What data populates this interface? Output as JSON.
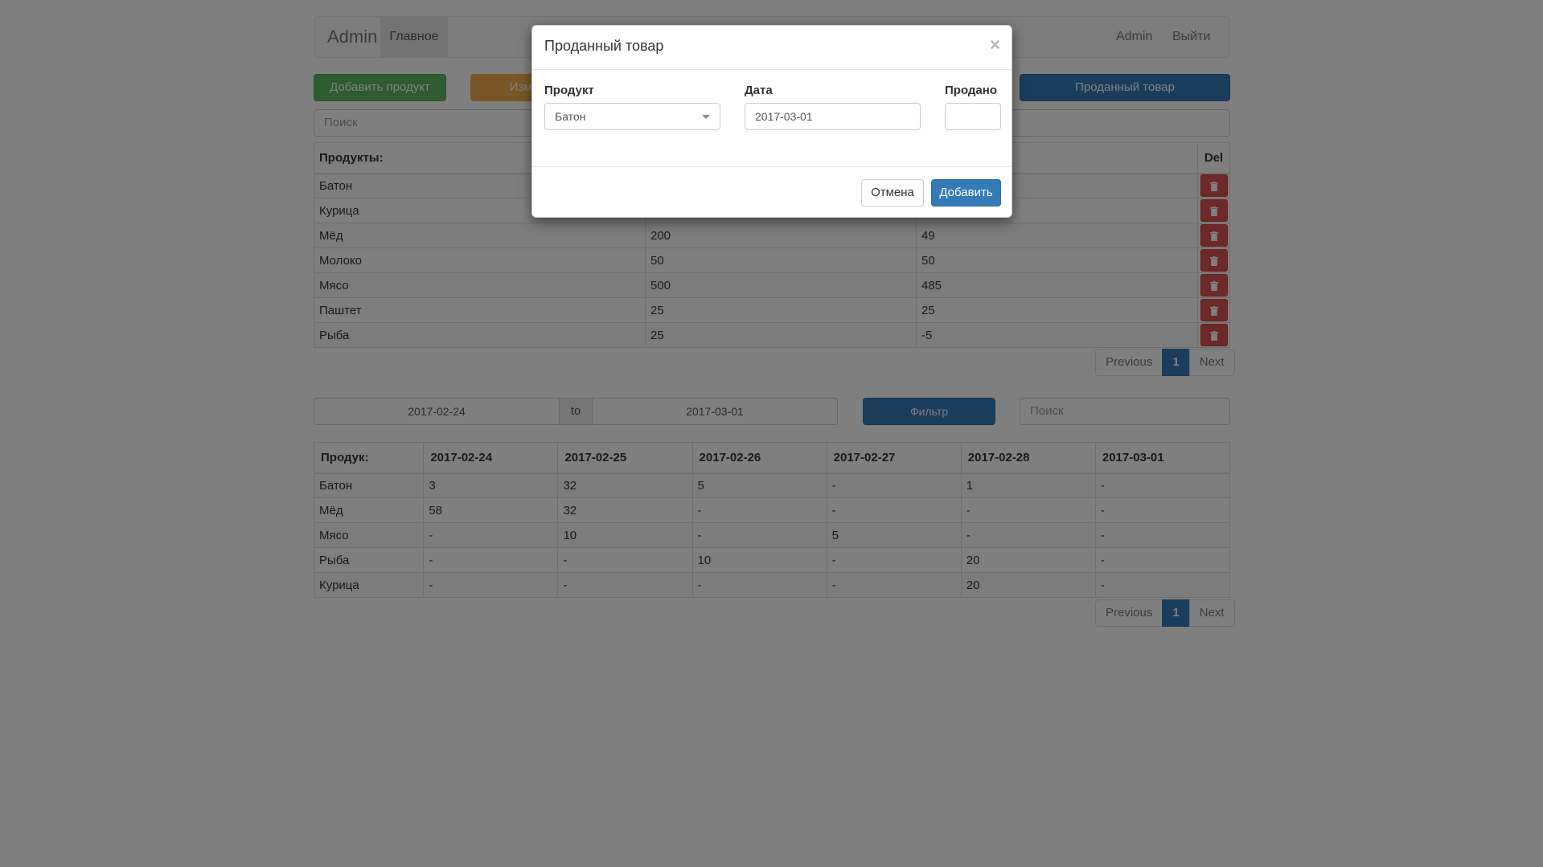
{
  "navbar": {
    "brand": "Admin",
    "home": "Главное",
    "user": "Admin",
    "logout": "Выйти"
  },
  "toolbar": {
    "add_product": "Добавить продукт",
    "edit": "Изменить",
    "sold_goods": "Проданный товар"
  },
  "search": {
    "placeholder": "Поиск"
  },
  "products_table": {
    "headers": {
      "name": "Продукты:",
      "del": "Del"
    },
    "rows": [
      {
        "name": "Батон",
        "col2": "",
        "col3": ""
      },
      {
        "name": "Курица",
        "col2": "",
        "col3": ""
      },
      {
        "name": "Мёд",
        "col2": "200",
        "col3": "49"
      },
      {
        "name": "Молоко",
        "col2": "50",
        "col3": "50"
      },
      {
        "name": "Мясо",
        "col2": "500",
        "col3": "485"
      },
      {
        "name": "Паштет",
        "col2": "25",
        "col3": "25"
      },
      {
        "name": "Рыба",
        "col2": "25",
        "col3": "-5"
      }
    ]
  },
  "pagination": {
    "prev": "Previous",
    "page": "1",
    "next": "Next"
  },
  "filter": {
    "from": "2017-02-24",
    "sep": "to",
    "to": "2017-03-01",
    "button": "Фильтр",
    "search_placeholder": "Поиск"
  },
  "sales_table": {
    "headers": [
      "Продук:",
      "2017-02-24",
      "2017-02-25",
      "2017-02-26",
      "2017-02-27",
      "2017-02-28",
      "2017-03-01"
    ],
    "rows": [
      [
        "Батон",
        "3",
        "32",
        "5",
        "-",
        "1",
        "-"
      ],
      [
        "Мёд",
        "58",
        "32",
        "-",
        "-",
        "-",
        "-"
      ],
      [
        "Мясо",
        "-",
        "10",
        "-",
        "5",
        "-",
        "-"
      ],
      [
        "Рыба",
        "-",
        "-",
        "10",
        "-",
        "20",
        "-"
      ],
      [
        "Курица",
        "-",
        "-",
        "-",
        "-",
        "20",
        "-"
      ]
    ]
  },
  "modal": {
    "title": "Проданный товар",
    "close": "×",
    "product_label": "Продукт",
    "product_value": "Батон",
    "date_label": "Дата",
    "date_value": "2017-03-01",
    "sold_label": "Продано",
    "sold_value": "",
    "cancel": "Отмена",
    "submit": "Добавить"
  },
  "icons": {
    "delete": "trash-icon",
    "close": "close-icon",
    "dropdown": "chevron-down-icon"
  },
  "colors": {
    "primary": "#337ab7",
    "success": "#5cb85c",
    "warning": "#f0ad4e",
    "danger": "#d9534f"
  }
}
